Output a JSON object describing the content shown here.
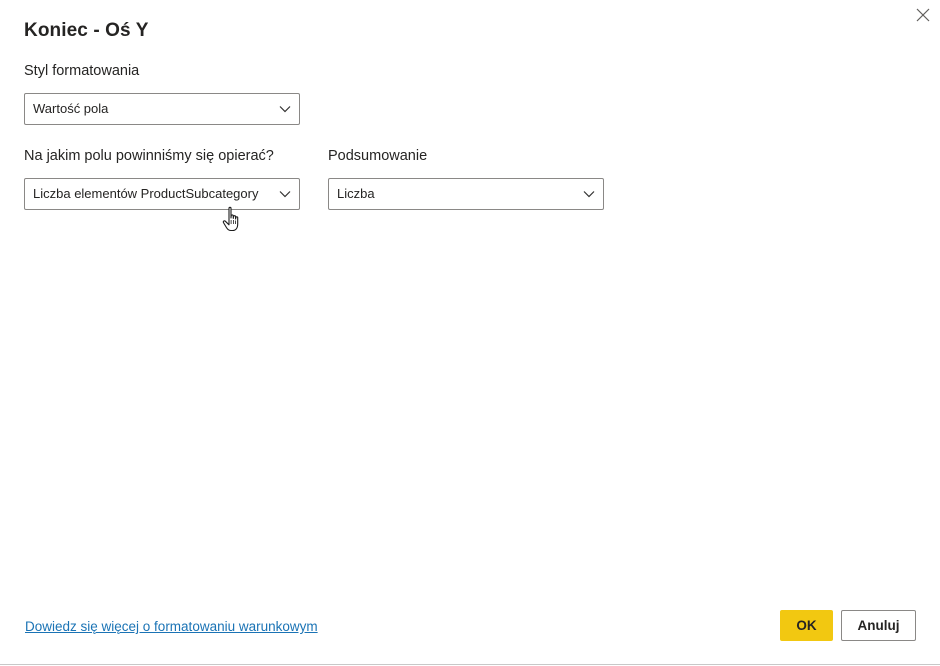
{
  "dialog": {
    "title": "Koniec - Oś Y",
    "close_icon": "close-icon"
  },
  "format_style": {
    "label": "Styl formatowania",
    "value": "Wartość pola"
  },
  "based_on_field": {
    "label": "Na jakim polu powinniśmy się opierać?",
    "value": "Liczba elementów ProductSubcategory"
  },
  "summarization": {
    "label": "Podsumowanie",
    "value": "Liczba"
  },
  "footer": {
    "learn_more_link": "Dowiedz się więcej o formatowaniu warunkowym",
    "ok_label": "OK",
    "cancel_label": "Anuluj"
  },
  "colors": {
    "accent": "#f2c811",
    "link": "#1a73b5",
    "border": "#8a8886",
    "text": "#252423"
  },
  "icons": {
    "dropdown": "chevron-down-icon",
    "cursor": "hand-pointer-icon"
  }
}
